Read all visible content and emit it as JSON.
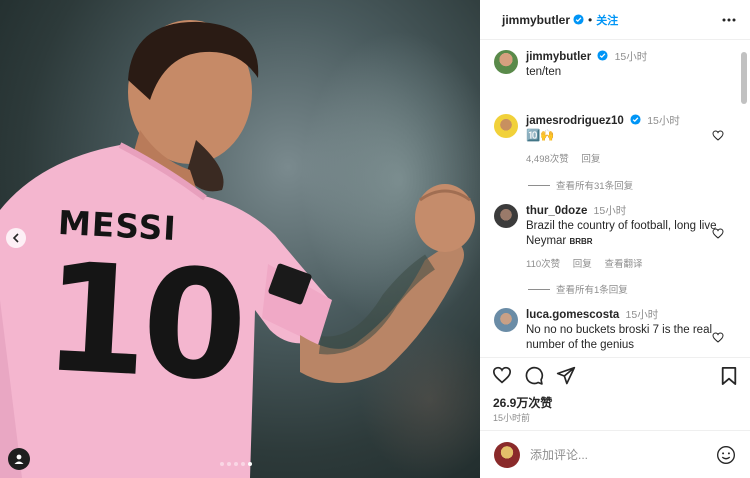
{
  "post": {
    "author": "jimmybutler",
    "follow_label": "关注",
    "separator": "•",
    "jersey_name": "MESSI",
    "jersey_number": "10",
    "caption_time": "15小时",
    "caption_text": "ten/ten",
    "likes": "26.9万次赞",
    "time_ago": "15小时前",
    "add_comment_placeholder": "添加评论...",
    "carousel": {
      "total": 5,
      "active_index": 4
    }
  },
  "comments": [
    {
      "user": "jamesrodriguez10",
      "verified": true,
      "time": "15小时",
      "text": "🔟🙌",
      "likes": "4,498次赞",
      "reply_label": "回复",
      "view_replies": "查看所有31条回复"
    },
    {
      "user": "thur_0doze",
      "verified": false,
      "time": "15小时",
      "text": "Brazil the country of football, long live Neymar",
      "flag_text": "BRBR",
      "likes": "110次赞",
      "reply_label": "回复",
      "translate_label": "查看翻译",
      "view_replies": "查看所有1条回复"
    },
    {
      "user": "luca.gomescosta",
      "verified": false,
      "time": "15小时",
      "text": "No no no buckets broski 7 is the real number of the genius"
    }
  ],
  "colors": {
    "accent": "#0095f6",
    "jersey_pink": "#f4b6cf",
    "muted": "#8e8e8e"
  },
  "icons": [
    "verified-icon",
    "more-icon",
    "heart-icon",
    "comment-icon",
    "share-icon",
    "bookmark-icon",
    "emoji-icon",
    "chevron-left-icon",
    "user-tag-icon"
  ]
}
